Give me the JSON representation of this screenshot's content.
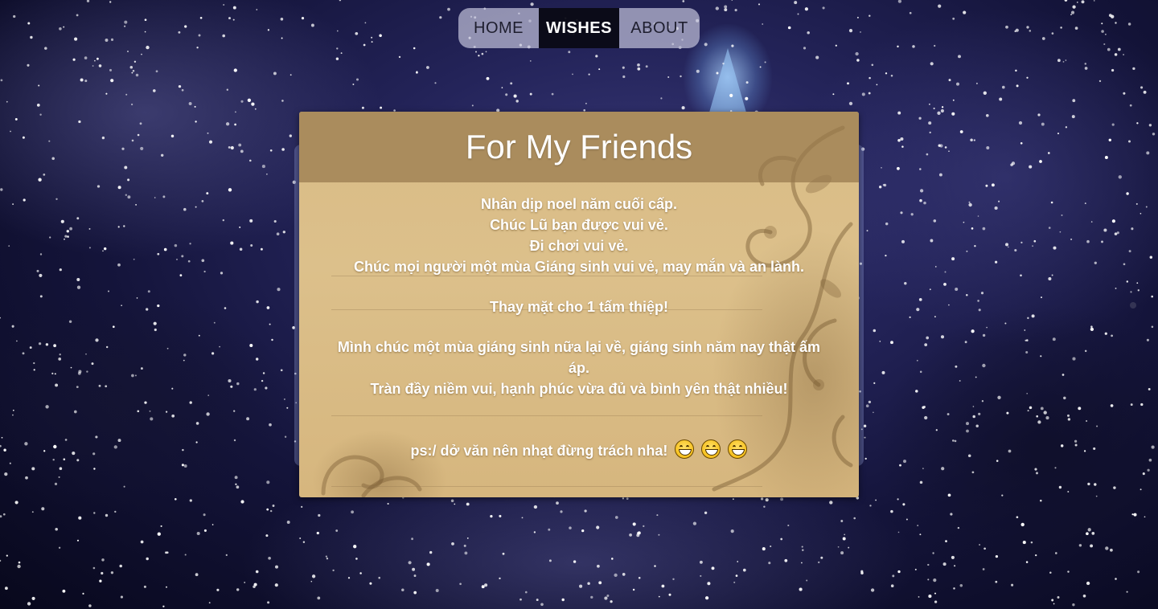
{
  "nav": {
    "items": [
      {
        "label": "HOME",
        "active": false
      },
      {
        "label": "WISHES",
        "active": true
      },
      {
        "label": "ABOUT",
        "active": false
      }
    ]
  },
  "card": {
    "title": "For My Friends",
    "paragraph1": [
      "Nhân dịp noel năm cuối cấp.",
      "Chúc Lũ bạn được vui vẻ.",
      "Đi chơi vui vẻ.",
      "Chúc mọi người một mùa Giáng sinh vui vẻ, may mắn và an lành."
    ],
    "paragraph2": "Thay mặt cho 1 tấm thiệp!",
    "paragraph3": [
      "Mình chúc một mùa giáng sinh nữa lại về, giáng sinh năm nay thật ấm áp.",
      "Tràn đầy niềm vui, hạnh phúc vừa đủ và bình yên thật nhiều!"
    ],
    "ps": "ps:/ dở văn nên nhạt đừng trách nha!",
    "emoji_icon": "grinning-face-icon",
    "emoji_count": 3
  },
  "colors": {
    "nav_active_bg": "#0a0a14",
    "nav_idle_bg": "#bebed7",
    "card_bg": "#d9bb85",
    "card_header_bg": "#96784b",
    "sky": "#14143a"
  }
}
